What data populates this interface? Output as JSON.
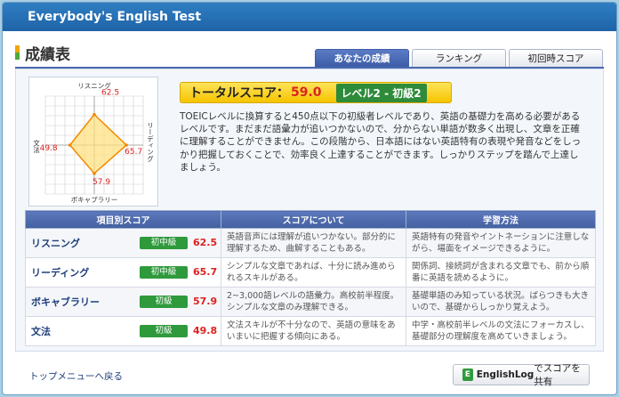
{
  "window": {
    "title": "Everybody's English Test"
  },
  "page": {
    "heading": "成績表"
  },
  "tabs": [
    {
      "label": "あなたの成績",
      "active": true
    },
    {
      "label": "ランキング",
      "active": false
    },
    {
      "label": "初回時スコア",
      "active": false
    }
  ],
  "radar": {
    "axes": [
      "リスニング",
      "リーディング",
      "ボキャブラリー",
      "文法"
    ],
    "values": [
      62.5,
      65.7,
      57.9,
      49.8
    ],
    "value_labels": [
      "62.5",
      "65.7",
      "57.9",
      "49.8"
    ],
    "max": 100,
    "colors": {
      "fill": "#ffe07a",
      "stroke": "#f08a00",
      "grid": "#cfcfcf",
      "label": "#d22"
    }
  },
  "total": {
    "label": "トータルスコア：",
    "value": "59.0",
    "level": "レベル2 - 初級2"
  },
  "summary": "TOEICレベルに換算すると450点以下の初級者レベルであり、英語の基礎力を高める必要があるレベルです。まだまだ語彙力が追いつかないので、分からない単語が数多く出現し、文章を正確に理解することができません。この段階から、日本語にはない英語特有の表現や発音などをしっかり把握しておくことで、効率良く上達することができます。しっかりステップを踏んで上達しましょう。",
  "table": {
    "headers": [
      "項目別スコア",
      "スコアについて",
      "学習方法"
    ],
    "rows": [
      {
        "name": "リスニング",
        "level": "初中級",
        "score": "62.5",
        "about": "英語音声には理解が追いつかない。部分的に理解するため、曲解することもある。",
        "method": "英語特有の発音やイントネーションに注意しながら、場面をイメージできるように。"
      },
      {
        "name": "リーディング",
        "level": "初中級",
        "score": "65.7",
        "about": "シンプルな文章であれば、十分に読み進められるスキルがある。",
        "method": "関係詞、接続詞が含まれる文章でも、前から順番に英語を読めるように。"
      },
      {
        "name": "ボキャブラリー",
        "level": "初級",
        "score": "57.9",
        "about": "2~3,000語レベルの語彙力。高校前半程度。シンプルな文章のみ理解できる。",
        "method": "基礎単語のみ知っている状況。ばらつきも大きいので、基礎からしっかり覚えよう。"
      },
      {
        "name": "文法",
        "level": "初級",
        "score": "49.8",
        "about": "文法スキルが不十分なので、英語の意味をあいまいに把握する傾向にある。",
        "method": "中学・高校前半レベルの文法にフォーカスし、基礎部分の理解度を高めていきましょう。"
      }
    ]
  },
  "footer": {
    "back_link": "トップメニューへ戻る",
    "share_brand": "EnglishLog",
    "share_text": "でスコアを共有",
    "share_icon": "E"
  }
}
